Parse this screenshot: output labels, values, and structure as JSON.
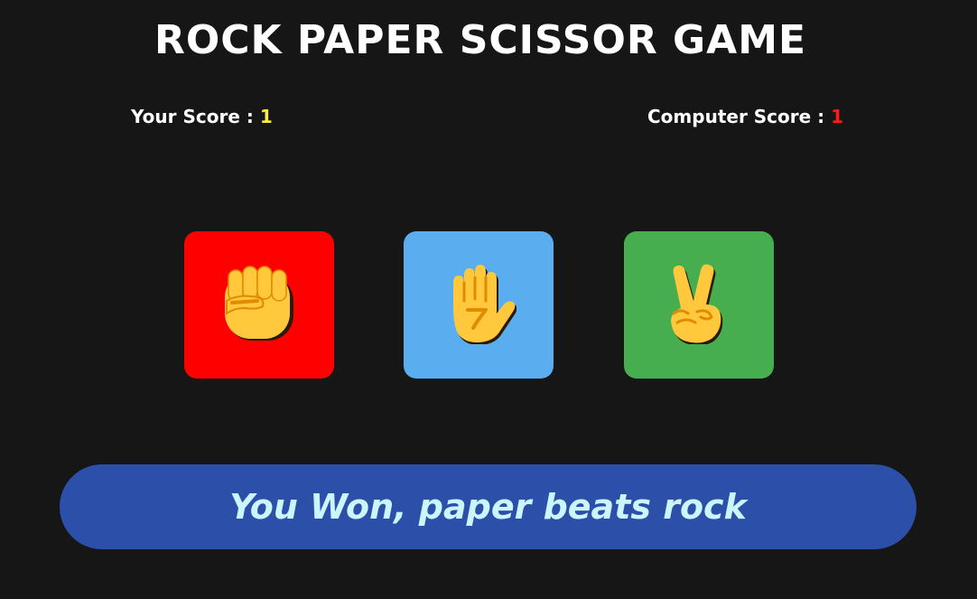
{
  "title": "ROCK PAPER SCISSOR GAME",
  "scores": {
    "user_label": "Your Score : ",
    "user_value": "1",
    "computer_label": "Computer Score : ",
    "computer_value": "1"
  },
  "choices": [
    {
      "name": "rock",
      "icon": "fist-icon",
      "color": "#ff0000"
    },
    {
      "name": "paper",
      "icon": "raised-hand-icon",
      "color": "#5aaef0"
    },
    {
      "name": "scissor",
      "icon": "victory-hand-icon",
      "color": "#47ae50"
    }
  ],
  "message": {
    "text": "You Won, paper beats rock",
    "background": "#2c4faa"
  },
  "colors": {
    "background": "#161616",
    "user_score": "#ffeb3b",
    "computer_score": "#ff1a1a",
    "message_text": "#ccf6ff"
  }
}
